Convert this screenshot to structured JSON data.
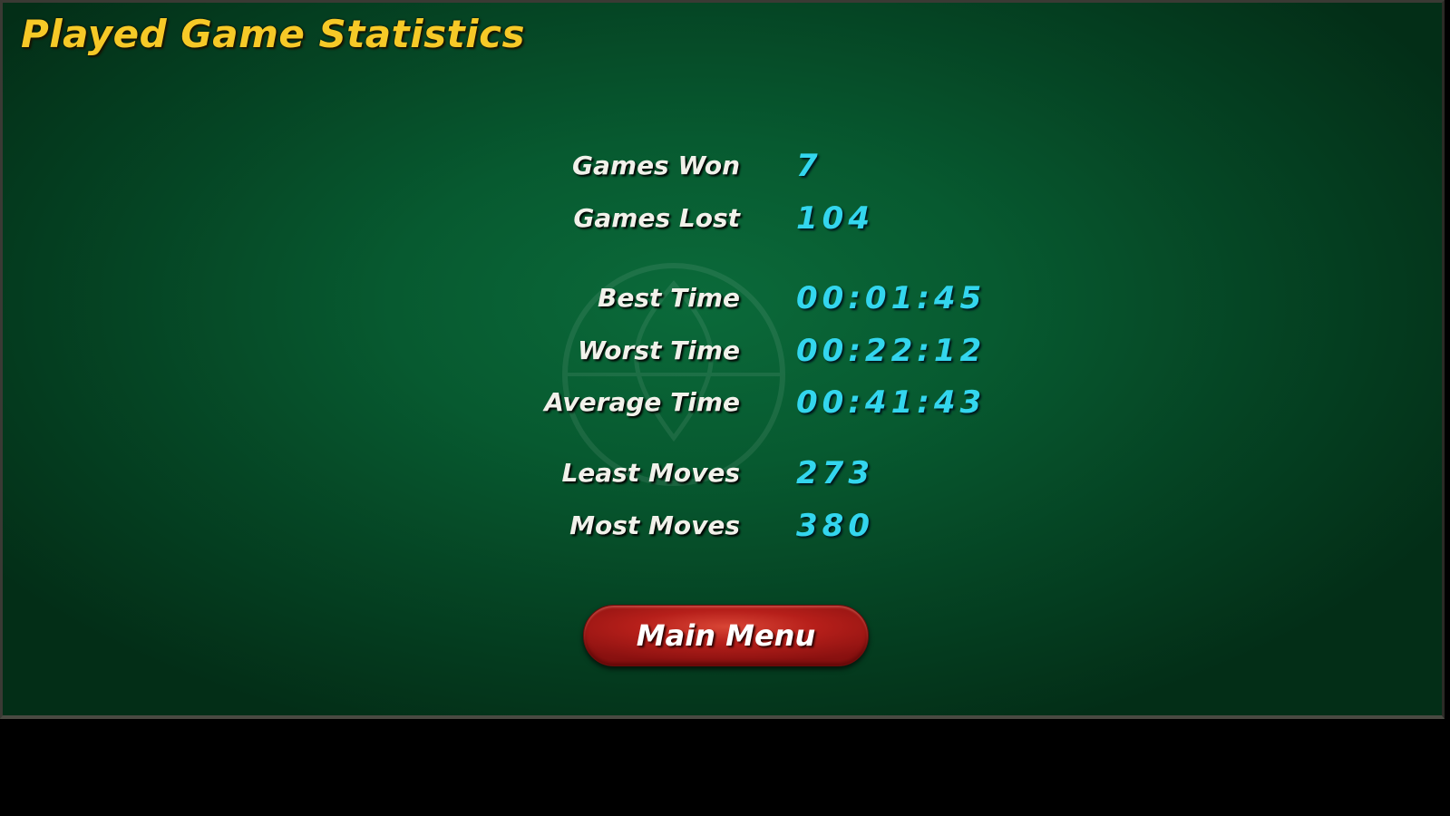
{
  "screen": {
    "title": "Played Game Statistics",
    "colors": {
      "felt": "#0b6a3a",
      "title": "#f6c927",
      "label": "#f1f1ea",
      "value": "#33d6ee",
      "button": "#b61f1a"
    }
  },
  "stats": [
    {
      "label": "Games Won",
      "value": "7"
    },
    {
      "label": "Games Lost",
      "value": "104"
    },
    {
      "label": "Best Time",
      "value": "00:01:45"
    },
    {
      "label": "Worst Time",
      "value": "00:22:12"
    },
    {
      "label": "Average Time",
      "value": "00:41:43"
    },
    {
      "label": "Least Moves",
      "value": "273"
    },
    {
      "label": "Most Moves",
      "value": "380"
    }
  ],
  "actions": {
    "main_menu_label": "Main Menu"
  }
}
